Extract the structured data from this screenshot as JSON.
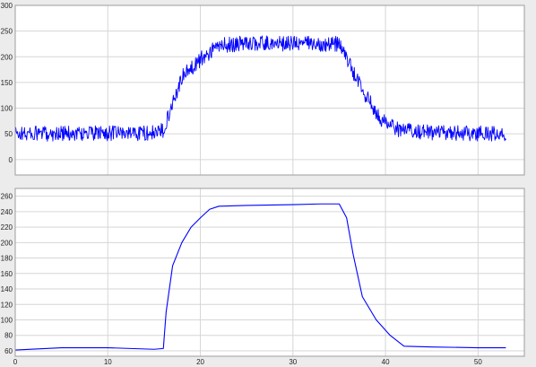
{
  "chart_data": [
    {
      "type": "line",
      "title": "",
      "xlabel": "",
      "ylabel": "",
      "xlim": [
        0,
        55
      ],
      "ylim": [
        -30,
        300
      ],
      "yticks": [
        0,
        50,
        100,
        150,
        200,
        250,
        300
      ],
      "xticks": [
        0,
        10,
        20,
        30,
        40,
        50
      ],
      "grid": true,
      "series": [
        {
          "color": "#0000ff",
          "noise_amplitude": 15,
          "x_end": 53,
          "envelope_x": [
            0,
            15.5,
            16,
            17,
            18,
            20,
            22,
            25,
            30,
            35,
            35.5,
            36.5,
            38,
            39.5,
            41,
            45,
            53
          ],
          "envelope_y": [
            50,
            52,
            58,
            110,
            160,
            195,
            222,
            226,
            226,
            225,
            210,
            170,
            120,
            80,
            60,
            52,
            50
          ]
        }
      ]
    },
    {
      "type": "line",
      "title": "",
      "xlabel": "",
      "ylabel": "",
      "xlim": [
        0,
        55
      ],
      "ylim": [
        53,
        270
      ],
      "yticks": [
        60,
        80,
        100,
        120,
        140,
        160,
        180,
        200,
        220,
        240,
        260
      ],
      "xticks": [
        0,
        10,
        20,
        30,
        40,
        50
      ],
      "xticklabels": [
        "0",
        "10",
        "20",
        "30",
        "40",
        "50"
      ],
      "grid": true,
      "series": [
        {
          "color": "#0000ff",
          "x": [
            0,
            5,
            10,
            15,
            16,
            16.3,
            17,
            18,
            19,
            20,
            21,
            22,
            25,
            30,
            33,
            35,
            35.8,
            36.5,
            37.5,
            39,
            40.5,
            42,
            45,
            50,
            53
          ],
          "y": [
            61,
            64,
            64,
            62,
            63,
            110,
            170,
            200,
            220,
            232,
            243,
            247,
            248,
            249,
            250,
            250,
            232,
            185,
            130,
            100,
            80,
            66,
            65,
            64,
            64
          ]
        }
      ]
    }
  ]
}
